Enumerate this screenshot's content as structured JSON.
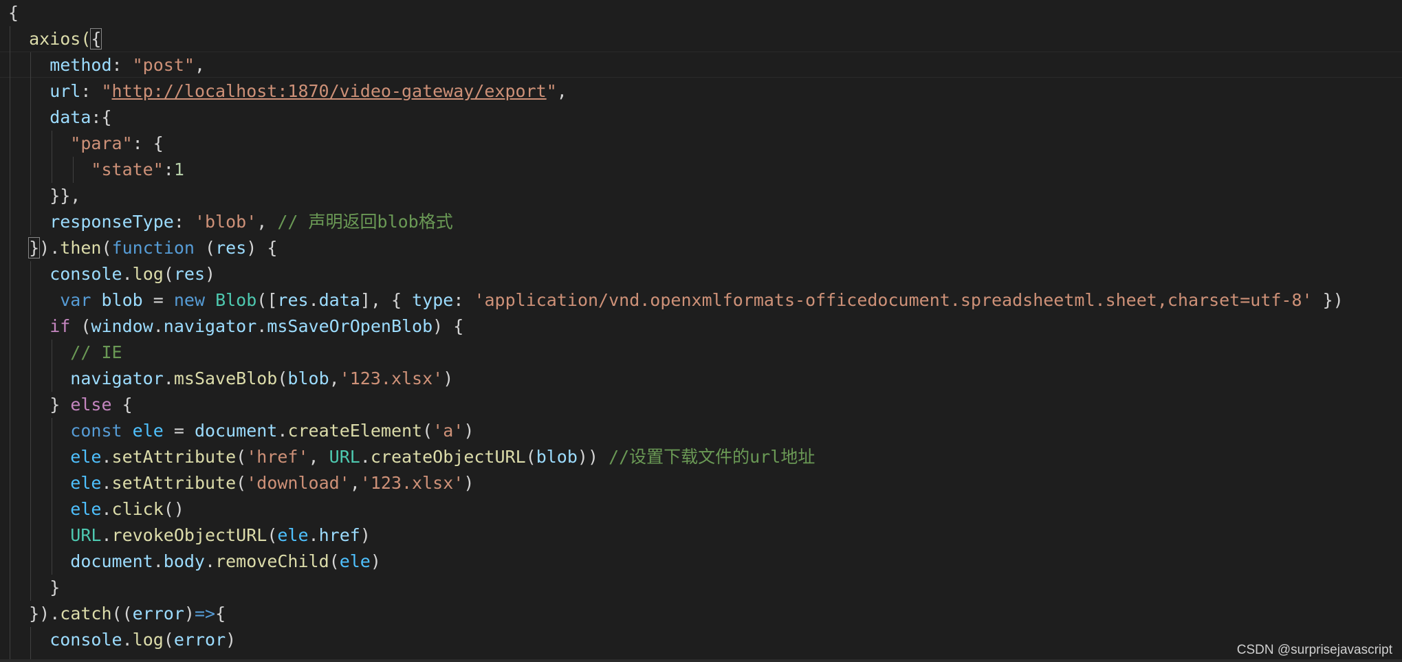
{
  "editor": {
    "background": "#1e1e1e",
    "lines": [
      [
        {
          "t": "{",
          "c": "punc"
        }
      ],
      [
        {
          "t": "  axios(",
          "c": "func"
        },
        {
          "t": "{",
          "c": "punc",
          "box": true
        }
      ],
      [
        {
          "t": "    method",
          "c": "prop"
        },
        {
          "t": ": ",
          "c": "punc"
        },
        {
          "t": "\"post\"",
          "c": "str"
        },
        {
          "t": ",",
          "c": "punc"
        }
      ],
      [
        {
          "t": "    url",
          "c": "prop"
        },
        {
          "t": ": ",
          "c": "punc"
        },
        {
          "t": "\"",
          "c": "str"
        },
        {
          "t": "http://localhost:1870/video-gateway/export",
          "c": "str",
          "url": true
        },
        {
          "t": "\"",
          "c": "str"
        },
        {
          "t": ",",
          "c": "punc"
        }
      ],
      [
        {
          "t": "    data",
          "c": "prop"
        },
        {
          "t": ":{",
          "c": "punc"
        }
      ],
      [
        {
          "t": "      \"para\"",
          "c": "str"
        },
        {
          "t": ": {",
          "c": "punc"
        }
      ],
      [
        {
          "t": "        \"state\"",
          "c": "str"
        },
        {
          "t": ":",
          "c": "punc"
        },
        {
          "t": "1",
          "c": "num"
        }
      ],
      [
        {
          "t": "    }},",
          "c": "punc"
        }
      ],
      [
        {
          "t": "    responseType",
          "c": "prop"
        },
        {
          "t": ": ",
          "c": "punc"
        },
        {
          "t": "'blob'",
          "c": "str"
        },
        {
          "t": ", ",
          "c": "punc"
        },
        {
          "t": "// 声明返回blob格式",
          "c": "cmt"
        }
      ],
      [
        {
          "t": "  ",
          "c": "punc"
        },
        {
          "t": "}",
          "c": "punc",
          "box": true
        },
        {
          "t": ").",
          "c": "punc"
        },
        {
          "t": "then",
          "c": "func"
        },
        {
          "t": "(",
          "c": "punc"
        },
        {
          "t": "function",
          "c": "kw"
        },
        {
          "t": " (",
          "c": "punc"
        },
        {
          "t": "res",
          "c": "var"
        },
        {
          "t": ") {",
          "c": "punc"
        }
      ],
      [
        {
          "t": "    console",
          "c": "var"
        },
        {
          "t": ".",
          "c": "punc"
        },
        {
          "t": "log",
          "c": "func"
        },
        {
          "t": "(",
          "c": "punc"
        },
        {
          "t": "res",
          "c": "var"
        },
        {
          "t": ")",
          "c": "punc"
        }
      ],
      [
        {
          "t": "     var",
          "c": "kw"
        },
        {
          "t": " ",
          "c": "punc"
        },
        {
          "t": "blob",
          "c": "var"
        },
        {
          "t": " = ",
          "c": "punc"
        },
        {
          "t": "new",
          "c": "kw"
        },
        {
          "t": " ",
          "c": "punc"
        },
        {
          "t": "Blob",
          "c": "type"
        },
        {
          "t": "([",
          "c": "punc"
        },
        {
          "t": "res",
          "c": "var"
        },
        {
          "t": ".",
          "c": "punc"
        },
        {
          "t": "data",
          "c": "var"
        },
        {
          "t": "], { ",
          "c": "punc"
        },
        {
          "t": "type",
          "c": "prop"
        },
        {
          "t": ": ",
          "c": "punc"
        },
        {
          "t": "'application/vnd.openxmlformats-officedocument.spreadsheetml.sheet,charset=utf-8'",
          "c": "str"
        },
        {
          "t": " })",
          "c": "punc"
        }
      ],
      [
        {
          "t": "    if",
          "c": "ctrl"
        },
        {
          "t": " (",
          "c": "punc"
        },
        {
          "t": "window",
          "c": "var"
        },
        {
          "t": ".",
          "c": "punc"
        },
        {
          "t": "navigator",
          "c": "var"
        },
        {
          "t": ".",
          "c": "punc"
        },
        {
          "t": "msSaveOrOpenBlob",
          "c": "var"
        },
        {
          "t": ") {",
          "c": "punc"
        }
      ],
      [
        {
          "t": "      // IE",
          "c": "cmt"
        }
      ],
      [
        {
          "t": "      navigator",
          "c": "var"
        },
        {
          "t": ".",
          "c": "punc"
        },
        {
          "t": "msSaveBlob",
          "c": "func"
        },
        {
          "t": "(",
          "c": "punc"
        },
        {
          "t": "blob",
          "c": "var"
        },
        {
          "t": ",",
          "c": "punc"
        },
        {
          "t": "'123.xlsx'",
          "c": "str"
        },
        {
          "t": ")",
          "c": "punc"
        }
      ],
      [
        {
          "t": "    } ",
          "c": "punc"
        },
        {
          "t": "else",
          "c": "ctrl"
        },
        {
          "t": " {",
          "c": "punc"
        }
      ],
      [
        {
          "t": "      const",
          "c": "kw"
        },
        {
          "t": " ",
          "c": "punc"
        },
        {
          "t": "ele",
          "c": "const"
        },
        {
          "t": " = ",
          "c": "punc"
        },
        {
          "t": "document",
          "c": "var"
        },
        {
          "t": ".",
          "c": "punc"
        },
        {
          "t": "createElement",
          "c": "func"
        },
        {
          "t": "(",
          "c": "punc"
        },
        {
          "t": "'a'",
          "c": "str"
        },
        {
          "t": ")",
          "c": "punc"
        }
      ],
      [
        {
          "t": "      ele",
          "c": "const"
        },
        {
          "t": ".",
          "c": "punc"
        },
        {
          "t": "setAttribute",
          "c": "func"
        },
        {
          "t": "(",
          "c": "punc"
        },
        {
          "t": "'href'",
          "c": "str"
        },
        {
          "t": ", ",
          "c": "punc"
        },
        {
          "t": "URL",
          "c": "type"
        },
        {
          "t": ".",
          "c": "punc"
        },
        {
          "t": "createObjectURL",
          "c": "func"
        },
        {
          "t": "(",
          "c": "punc"
        },
        {
          "t": "blob",
          "c": "var"
        },
        {
          "t": ")) ",
          "c": "punc"
        },
        {
          "t": "//设置下载文件的url地址",
          "c": "cmt"
        }
      ],
      [
        {
          "t": "      ele",
          "c": "const"
        },
        {
          "t": ".",
          "c": "punc"
        },
        {
          "t": "setAttribute",
          "c": "func"
        },
        {
          "t": "(",
          "c": "punc"
        },
        {
          "t": "'download'",
          "c": "str"
        },
        {
          "t": ",",
          "c": "punc"
        },
        {
          "t": "'123.xlsx'",
          "c": "str"
        },
        {
          "t": ")",
          "c": "punc"
        }
      ],
      [
        {
          "t": "      ele",
          "c": "const"
        },
        {
          "t": ".",
          "c": "punc"
        },
        {
          "t": "click",
          "c": "func"
        },
        {
          "t": "()",
          "c": "punc"
        }
      ],
      [
        {
          "t": "      URL",
          "c": "type"
        },
        {
          "t": ".",
          "c": "punc"
        },
        {
          "t": "revokeObjectURL",
          "c": "func"
        },
        {
          "t": "(",
          "c": "punc"
        },
        {
          "t": "ele",
          "c": "const"
        },
        {
          "t": ".",
          "c": "punc"
        },
        {
          "t": "href",
          "c": "var"
        },
        {
          "t": ")",
          "c": "punc"
        }
      ],
      [
        {
          "t": "      document",
          "c": "var"
        },
        {
          "t": ".",
          "c": "punc"
        },
        {
          "t": "body",
          "c": "var"
        },
        {
          "t": ".",
          "c": "punc"
        },
        {
          "t": "removeChild",
          "c": "func"
        },
        {
          "t": "(",
          "c": "punc"
        },
        {
          "t": "ele",
          "c": "const"
        },
        {
          "t": ")",
          "c": "punc"
        }
      ],
      [
        {
          "t": "    }",
          "c": "punc"
        }
      ],
      [
        {
          "t": "  }).",
          "c": "punc"
        },
        {
          "t": "catch",
          "c": "func"
        },
        {
          "t": "((",
          "c": "punc"
        },
        {
          "t": "error",
          "c": "var"
        },
        {
          "t": ")",
          "c": "punc"
        },
        {
          "t": "=>",
          "c": "kw"
        },
        {
          "t": "{",
          "c": "punc"
        }
      ],
      [
        {
          "t": "    console",
          "c": "var"
        },
        {
          "t": ".",
          "c": "punc"
        },
        {
          "t": "log",
          "c": "func"
        },
        {
          "t": "(",
          "c": "punc"
        },
        {
          "t": "error",
          "c": "var"
        },
        {
          "t": ")",
          "c": "punc"
        }
      ]
    ]
  },
  "watermark": {
    "text": "CSDN @surprisejavascript"
  }
}
